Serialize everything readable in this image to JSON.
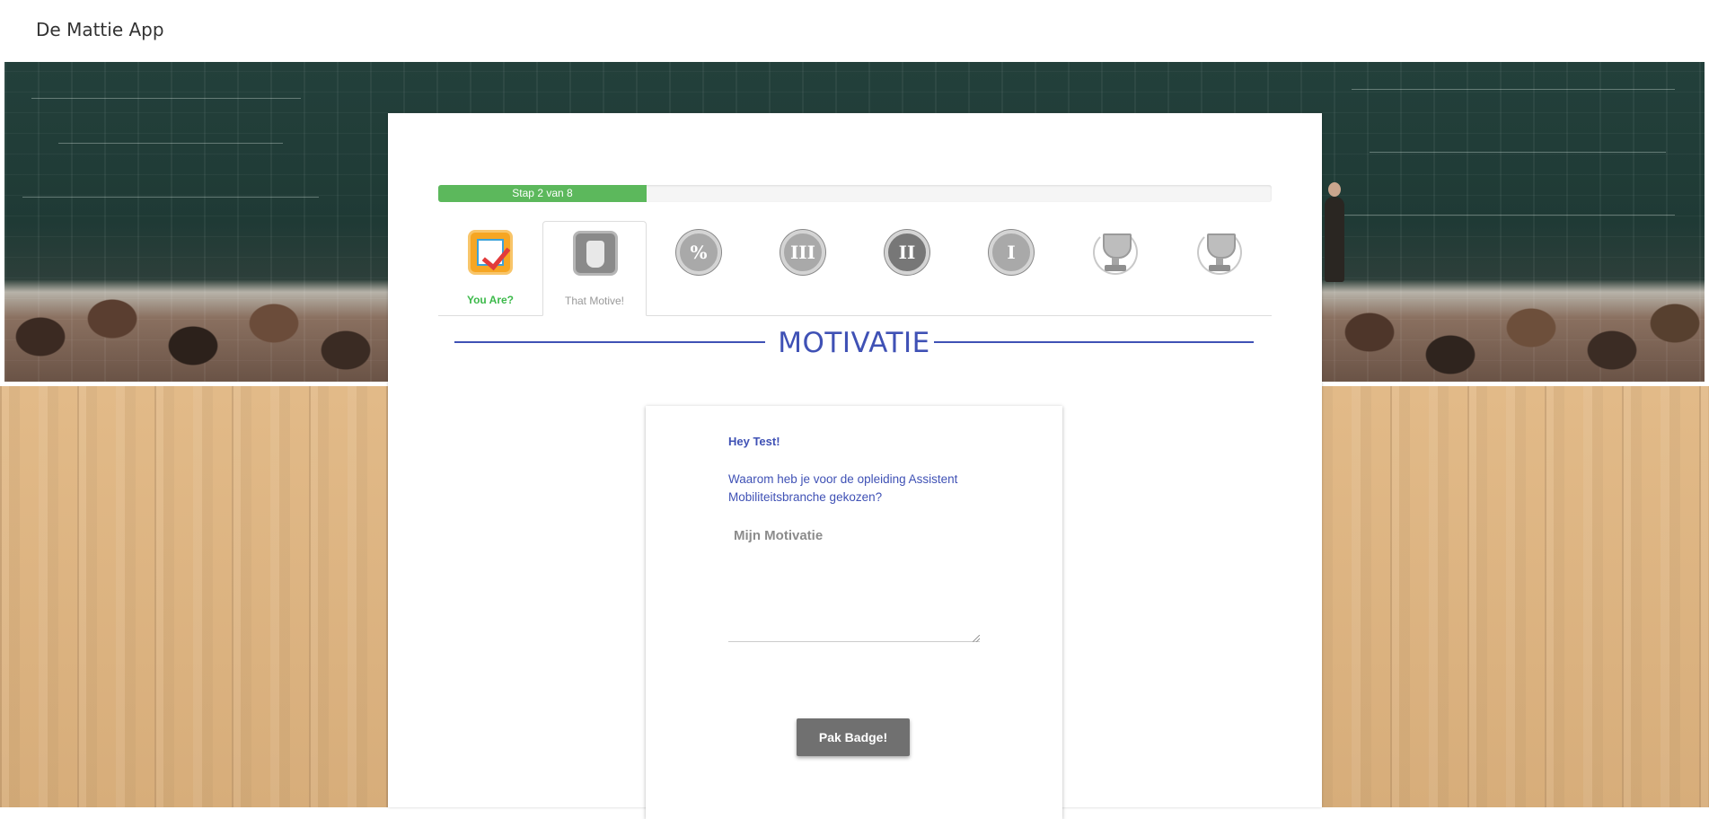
{
  "header": {
    "app_title": "De Mattie App"
  },
  "progress": {
    "label": "Stap 2 van 8",
    "current_step": 2,
    "total_steps": 8,
    "fraction": 0.25,
    "fill_color": "#5cb85c"
  },
  "badges": [
    {
      "icon": "checklist-badge-icon",
      "label": "You Are?",
      "state": "completed"
    },
    {
      "icon": "rock-hand-badge-icon",
      "label": "That Motive!",
      "state": "active"
    },
    {
      "icon": "percent-badge-icon",
      "label": "",
      "state": "locked"
    },
    {
      "icon": "roman-three-badge-icon",
      "label": "",
      "glyph": "III",
      "state": "locked"
    },
    {
      "icon": "roman-two-badge-icon",
      "label": "",
      "glyph": "II",
      "state": "locked"
    },
    {
      "icon": "roman-one-badge-icon",
      "label": "",
      "glyph": "I",
      "state": "locked"
    },
    {
      "icon": "trophy-badge-icon",
      "label": "",
      "state": "locked"
    },
    {
      "icon": "trophy-badge-icon",
      "label": "",
      "state": "locked"
    }
  ],
  "section": {
    "title": "MOTIVATIE",
    "accent_color": "#3f51b5"
  },
  "card": {
    "greeting": "Hey Test!",
    "question": "Waarom heb je voor de opleiding Assistent Mobiliteitsbranche gekozen?",
    "motivation_placeholder": "Mijn Motivatie",
    "motivation_value": "",
    "submit_label": "Pak Badge!"
  }
}
